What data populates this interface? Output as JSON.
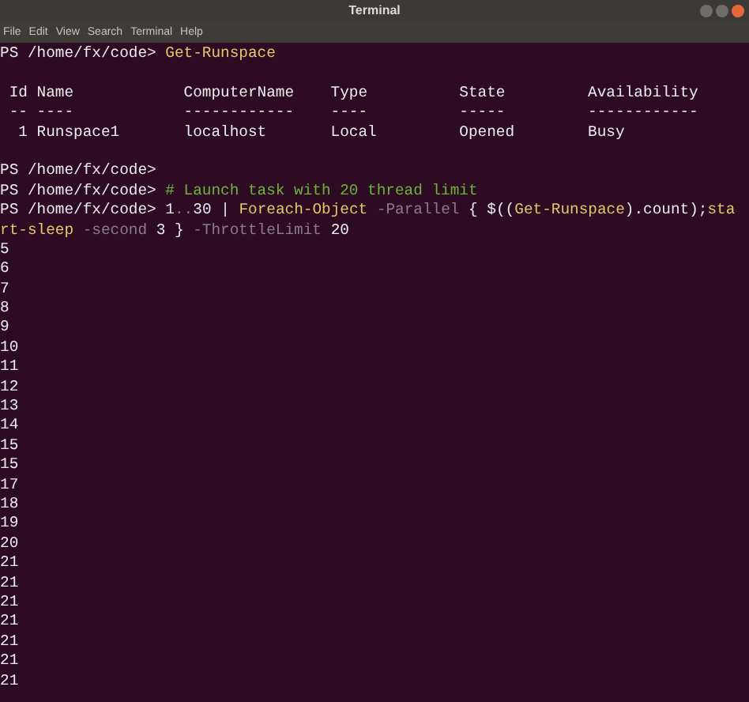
{
  "window": {
    "title": "Terminal"
  },
  "menu": [
    "File",
    "Edit",
    "View",
    "Search",
    "Terminal",
    "Help"
  ],
  "lines": [
    [
      {
        "kind": "prompt",
        "text": "PS /home/fx/code> "
      },
      {
        "kind": "command",
        "text": "Get-Runspace"
      }
    ],
    [
      {
        "kind": "blank"
      }
    ],
    [
      {
        "kind": "plain",
        "text": " Id Name            ComputerName    Type          State         Availability"
      }
    ],
    [
      {
        "kind": "plain",
        "text": " -- ----            ------------    ----          -----         ------------"
      }
    ],
    [
      {
        "kind": "plain",
        "text": "  1 Runspace1       localhost       Local         Opened        Busy"
      }
    ],
    [
      {
        "kind": "blank"
      }
    ],
    [
      {
        "kind": "prompt",
        "text": "PS /home/fx/code>"
      }
    ],
    [
      {
        "kind": "prompt",
        "text": "PS /home/fx/code> "
      },
      {
        "kind": "comment",
        "text": "# Launch task with 20 thread limit"
      }
    ],
    [
      {
        "kind": "prompt",
        "text": "PS /home/fx/code> "
      },
      {
        "kind": "plain",
        "text": "1"
      },
      {
        "kind": "operator",
        "text": ".."
      },
      {
        "kind": "plain",
        "text": "30 | "
      },
      {
        "kind": "command",
        "text": "Foreach-Object"
      },
      {
        "kind": "parameter",
        "text": " -Parallel"
      },
      {
        "kind": "plain",
        "text": " { $(("
      },
      {
        "kind": "command",
        "text": "Get-Runspace"
      },
      {
        "kind": "plain",
        "text": ").count);"
      },
      {
        "kind": "command",
        "text": "sta"
      }
    ],
    [
      {
        "kind": "command",
        "text": "rt-sleep"
      },
      {
        "kind": "parameter",
        "text": " -second"
      },
      {
        "kind": "plain",
        "text": " 3 } "
      },
      {
        "kind": "parameter",
        "text": "-ThrottleLimit"
      },
      {
        "kind": "plain",
        "text": " 20"
      }
    ],
    [
      {
        "kind": "output",
        "text": "5"
      }
    ],
    [
      {
        "kind": "output",
        "text": "6"
      }
    ],
    [
      {
        "kind": "output",
        "text": "7"
      }
    ],
    [
      {
        "kind": "output",
        "text": "8"
      }
    ],
    [
      {
        "kind": "output",
        "text": "9"
      }
    ],
    [
      {
        "kind": "output",
        "text": "10"
      }
    ],
    [
      {
        "kind": "output",
        "text": "11"
      }
    ],
    [
      {
        "kind": "output",
        "text": "12"
      }
    ],
    [
      {
        "kind": "output",
        "text": "13"
      }
    ],
    [
      {
        "kind": "output",
        "text": "14"
      }
    ],
    [
      {
        "kind": "output",
        "text": "15"
      }
    ],
    [
      {
        "kind": "output",
        "text": "15"
      }
    ],
    [
      {
        "kind": "output",
        "text": "17"
      }
    ],
    [
      {
        "kind": "output",
        "text": "18"
      }
    ],
    [
      {
        "kind": "output",
        "text": "19"
      }
    ],
    [
      {
        "kind": "output",
        "text": "20"
      }
    ],
    [
      {
        "kind": "output",
        "text": "21"
      }
    ],
    [
      {
        "kind": "output",
        "text": "21"
      }
    ],
    [
      {
        "kind": "output",
        "text": "21"
      }
    ],
    [
      {
        "kind": "output",
        "text": "21"
      }
    ],
    [
      {
        "kind": "output",
        "text": "21"
      }
    ],
    [
      {
        "kind": "output",
        "text": "21"
      }
    ],
    [
      {
        "kind": "output",
        "text": "21"
      }
    ]
  ]
}
